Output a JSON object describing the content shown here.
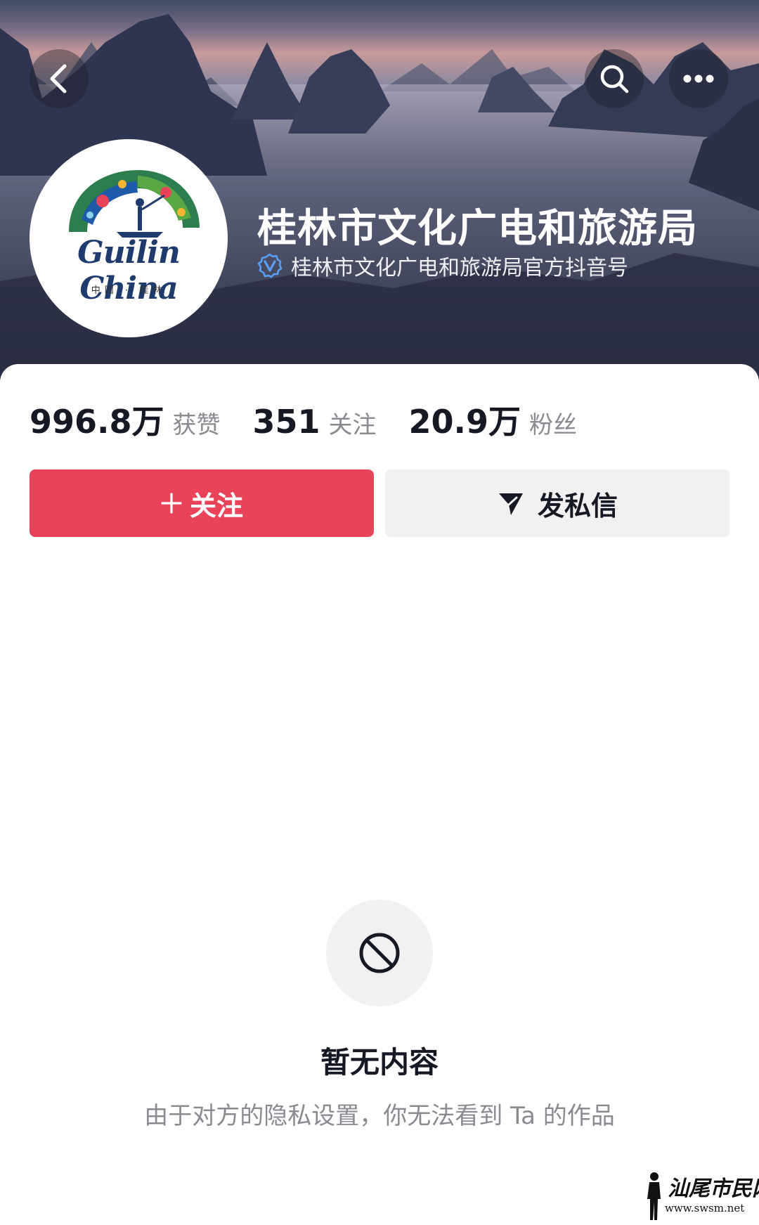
{
  "header": {
    "account_name": "桂林市文化广电和旅游局",
    "verification": "桂林市文化广电和旅游局官方抖音号",
    "avatar_logo": {
      "text": "Guilin China",
      "subtext": "中国 · 桂林"
    },
    "icons": {
      "back": "chevron-left-icon",
      "search": "search-icon",
      "more": "more-dots-icon",
      "verified": "verified-badge-icon"
    }
  },
  "stats": [
    {
      "value": "996.8万",
      "label": "获赞"
    },
    {
      "value": "351",
      "label": "关注"
    },
    {
      "value": "20.9万",
      "label": "粉丝"
    }
  ],
  "actions": {
    "follow_label": "关注",
    "message_label": "发私信",
    "follow_color": "#e9435a"
  },
  "empty_state": {
    "icon": "prohibited-icon",
    "title": "暂无内容",
    "description": "由于对方的隐私设置，你无法看到 Ta 的作品"
  },
  "watermark": {
    "text": "汕尾市民网",
    "url": "www.swsm.net"
  }
}
